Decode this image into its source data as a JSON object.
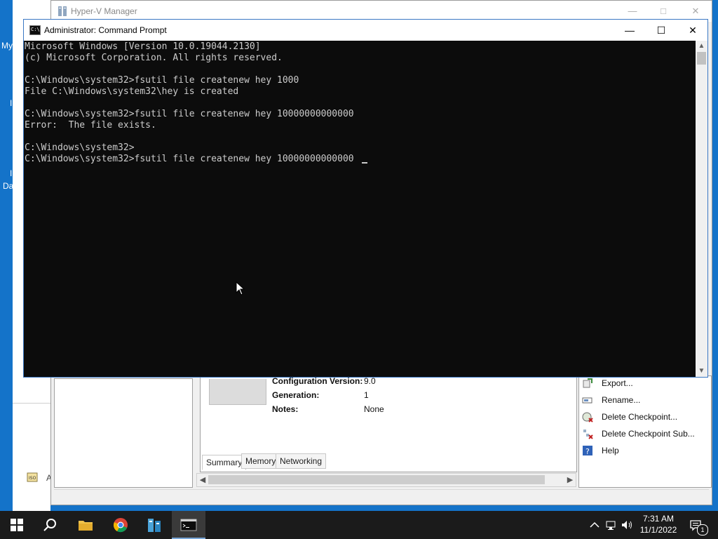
{
  "desktop": {
    "fragments": [
      "My",
      "I",
      "I",
      "Da",
      "A"
    ]
  },
  "hyperv": {
    "title": "Hyper-V Manager",
    "details": [
      {
        "label": "Configuration Version:",
        "value": "9.0"
      },
      {
        "label": "Generation:",
        "value": "1"
      },
      {
        "label": "Notes:",
        "value": "None"
      }
    ],
    "tabs": [
      "Summary",
      "Memory",
      "Networking"
    ],
    "actions": [
      "Export...",
      "Rename...",
      "Delete Checkpoint...",
      "Delete Checkpoint Sub...",
      "Help"
    ]
  },
  "cmd": {
    "title": "Administrator: Command Prompt",
    "lines": [
      "Microsoft Windows [Version 10.0.19044.2130]",
      "(c) Microsoft Corporation. All rights reserved.",
      "",
      "C:\\Windows\\system32>fsutil file createnew hey 1000",
      "File C:\\Windows\\system32\\hey is created",
      "",
      "C:\\Windows\\system32>fsutil file createnew hey 10000000000000",
      "Error:  The file exists.",
      "",
      "C:\\Windows\\system32>",
      "C:\\Windows\\system32>fsutil file createnew hey 10000000000000"
    ]
  },
  "taskbar": {
    "time": "7:31 AM",
    "date": "11/1/2022",
    "notification_count": "1"
  }
}
